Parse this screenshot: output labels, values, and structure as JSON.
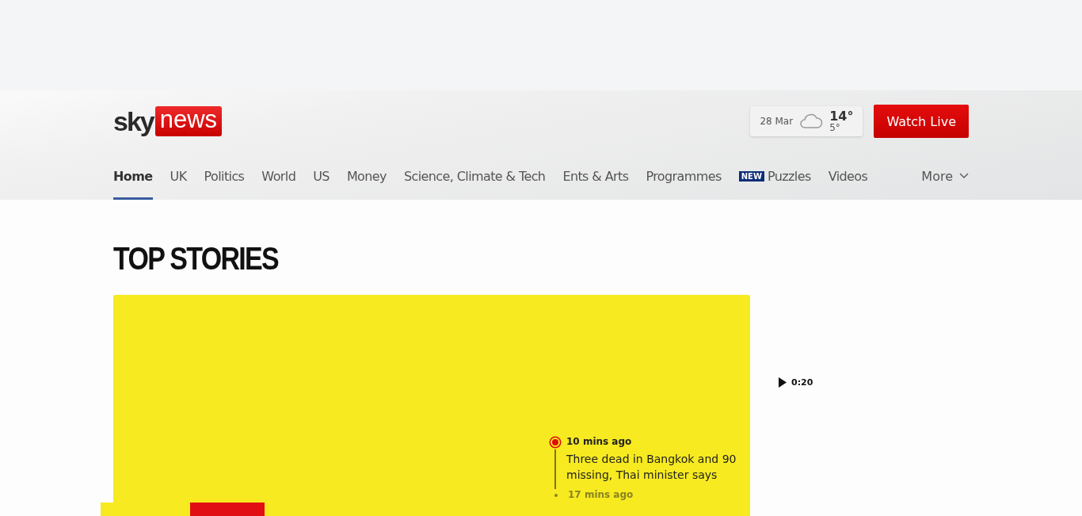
{
  "header": {
    "logo": {
      "sky": "sky",
      "news": "news"
    },
    "weather": {
      "date": "28 Mar",
      "high": "14°",
      "low": "5°"
    },
    "watch_live": "Watch Live"
  },
  "nav": {
    "items": [
      {
        "label": "Home",
        "selected": true
      },
      {
        "label": "UK",
        "selected": false
      },
      {
        "label": "Politics",
        "selected": false
      },
      {
        "label": "World",
        "selected": false
      },
      {
        "label": "US",
        "selected": false
      },
      {
        "label": "Money",
        "selected": false
      },
      {
        "label": "Science, Climate & Tech",
        "selected": false
      },
      {
        "label": "Ents & Arts",
        "selected": false
      },
      {
        "label": "Programmes",
        "selected": false
      },
      {
        "label": "Puzzles",
        "selected": false,
        "badge": "NEW"
      },
      {
        "label": "Videos",
        "selected": false
      }
    ],
    "more": "More"
  },
  "section_title": "TOP STORIES",
  "lead_story": {
    "tags": [
      {
        "kind": "breaking"
      },
      {
        "kind": "live"
      }
    ],
    "timeline": [
      {
        "time": "10 mins ago",
        "text": "Three dead in Bangkok and 90 missing, Thai minister says",
        "latest": true
      },
      {
        "time": "17 mins ago",
        "latest": false
      }
    ]
  },
  "video": {
    "duration": "0:20"
  }
}
